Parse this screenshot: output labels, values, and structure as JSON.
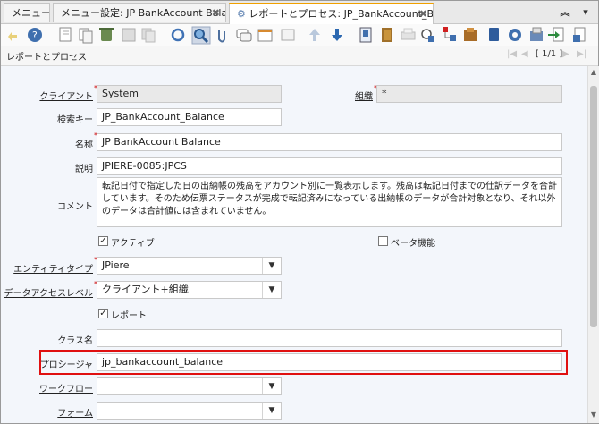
{
  "tabs": [
    {
      "label": "メニュー"
    },
    {
      "label": "メニュー設定: JP BankAccount Balance"
    },
    {
      "label": "レポートとプロセス: JP_BankAccount_B..."
    }
  ],
  "window": {
    "title": "レポートとプロセス",
    "record_nav": "[ 1/1 ]"
  },
  "form": {
    "client": {
      "label": "クライアント",
      "value": "System"
    },
    "org": {
      "label": "組織",
      "value": "*"
    },
    "search_key": {
      "label": "検索キー",
      "value": "JP_BankAccount_Balance"
    },
    "name": {
      "label": "名称",
      "value": "JP BankAccount Balance"
    },
    "description": {
      "label": "説明",
      "value": "JPIERE-0085:JPCS"
    },
    "comment": {
      "label": "コメント",
      "value": "転記日付で指定した日の出納帳の残高をアカウント別に一覧表示します。残高は転記日付までの仕訳データを合計しています。そのため伝票ステータスが完成で転記済みになっている出納帳のデータが合計対象となり、それ以外のデータは合計値には含まれていません。"
    },
    "active": {
      "label": "アクティブ",
      "checked": true
    },
    "beta": {
      "label": "ベータ機能",
      "checked": false
    },
    "entity_type": {
      "label": "エンティティタイプ",
      "value": "JPiere"
    },
    "data_access": {
      "label": "データアクセスレベル",
      "value": "クライアント+組織"
    },
    "report": {
      "label": "レポート",
      "checked": true
    },
    "class_name": {
      "label": "クラス名",
      "value": ""
    },
    "procedure": {
      "label": "プロシージャ",
      "value": "jp_bankaccount_balance"
    },
    "workflow": {
      "label": "ワークフロー",
      "value": ""
    },
    "form_field": {
      "label": "フォーム",
      "value": ""
    }
  },
  "colors": {
    "accent": "#f0a000",
    "highlight": "#e01010",
    "required": "#cc0000"
  }
}
